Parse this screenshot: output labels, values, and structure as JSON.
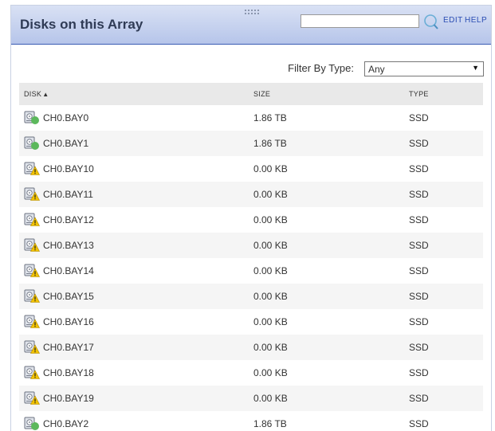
{
  "panel": {
    "title": "Disks on this Array",
    "search_value": "",
    "edit_label": "EDIT",
    "help_label": "HELP"
  },
  "filter": {
    "label": "Filter By Type:",
    "selected": "Any"
  },
  "table": {
    "columns": {
      "disk": "DISK",
      "size": "SIZE",
      "type": "TYPE"
    },
    "sort": {
      "column": "disk",
      "direction": "ascending"
    },
    "rows": [
      {
        "disk": "CH0.BAY0",
        "size": "1.86 TB",
        "type": "SSD",
        "status": "ok"
      },
      {
        "disk": "CH0.BAY1",
        "size": "1.86 TB",
        "type": "SSD",
        "status": "ok"
      },
      {
        "disk": "CH0.BAY10",
        "size": "0.00 KB",
        "type": "SSD",
        "status": "warning"
      },
      {
        "disk": "CH0.BAY11",
        "size": "0.00 KB",
        "type": "SSD",
        "status": "warning"
      },
      {
        "disk": "CH0.BAY12",
        "size": "0.00 KB",
        "type": "SSD",
        "status": "warning"
      },
      {
        "disk": "CH0.BAY13",
        "size": "0.00 KB",
        "type": "SSD",
        "status": "warning"
      },
      {
        "disk": "CH0.BAY14",
        "size": "0.00 KB",
        "type": "SSD",
        "status": "warning"
      },
      {
        "disk": "CH0.BAY15",
        "size": "0.00 KB",
        "type": "SSD",
        "status": "warning"
      },
      {
        "disk": "CH0.BAY16",
        "size": "0.00 KB",
        "type": "SSD",
        "status": "warning"
      },
      {
        "disk": "CH0.BAY17",
        "size": "0.00 KB",
        "type": "SSD",
        "status": "warning"
      },
      {
        "disk": "CH0.BAY18",
        "size": "0.00 KB",
        "type": "SSD",
        "status": "warning"
      },
      {
        "disk": "CH0.BAY19",
        "size": "0.00 KB",
        "type": "SSD",
        "status": "warning"
      },
      {
        "disk": "CH0.BAY2",
        "size": "1.86 TB",
        "type": "SSD",
        "status": "ok"
      }
    ]
  },
  "icons": {
    "search": "search-icon",
    "drag": "drag-handle-icon",
    "disk": "disk-drive-icon",
    "ok": "status-ok-icon",
    "warning": "status-warning-icon",
    "sort_ascending": "sort-ascending-icon",
    "dropdown": "chevron-down-icon"
  },
  "colors": {
    "header_top": "#d9e1f4",
    "header_bottom": "#b6c5ea",
    "header_border": "#3b5cb4",
    "link": "#2a4db3",
    "ok": "#5cb85c",
    "warning": "#f2c200",
    "row_stripe": "#f5f5f5",
    "column_header_bg": "#e9e9e9"
  }
}
